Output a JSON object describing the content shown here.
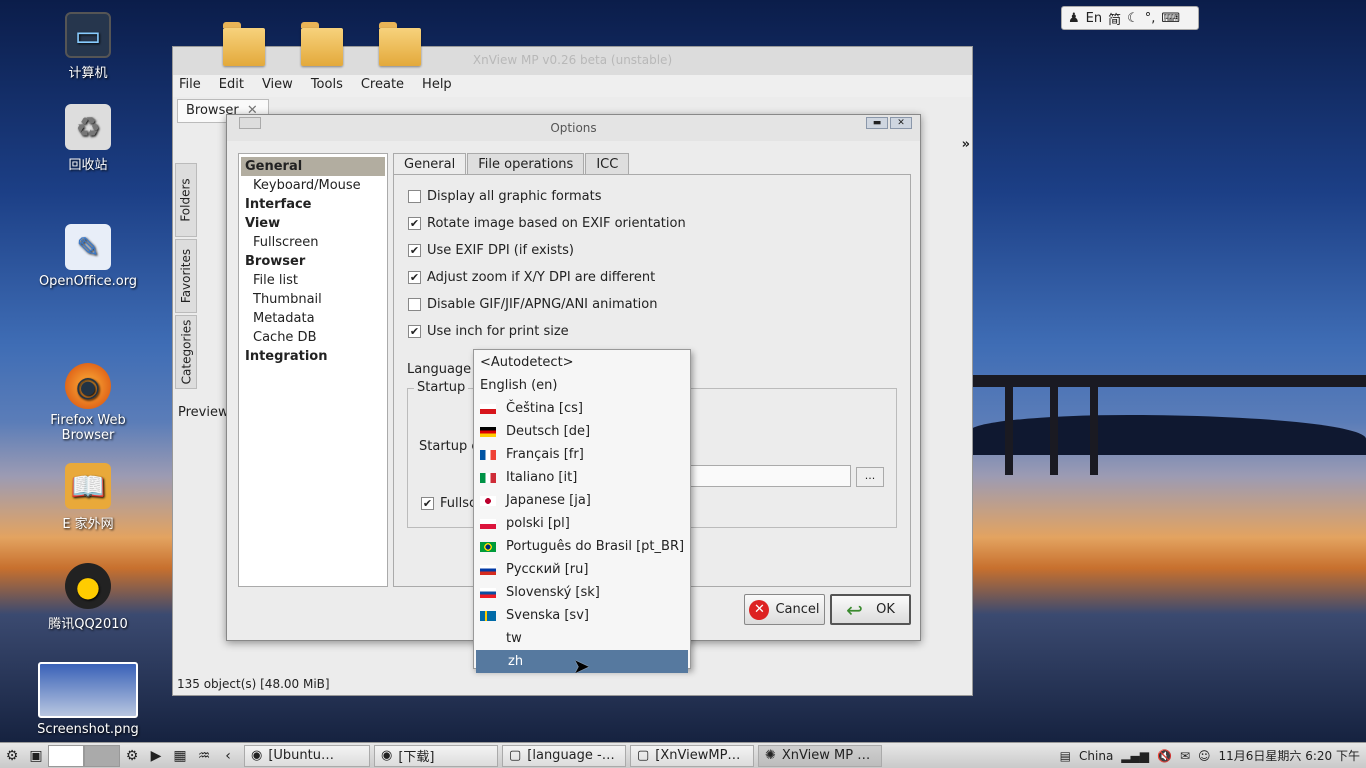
{
  "desktop": {
    "icons": [
      {
        "label": "计算机",
        "icon": "computer-icon"
      },
      {
        "label": "回收站",
        "icon": "trash-icon"
      },
      {
        "label": "OpenOffice.org",
        "icon": "openoffice-icon"
      },
      {
        "label": "Firefox Web Browser",
        "icon": "firefox-icon"
      },
      {
        "label": "E 家外网",
        "icon": "book-icon"
      },
      {
        "label": "腾讯QQ2010",
        "icon": "qq-penguin-icon"
      },
      {
        "label": "Screenshot.png",
        "icon": "image-thumbnail-icon"
      }
    ]
  },
  "ime": {
    "lang": "En",
    "mode": "简"
  },
  "xnview": {
    "title": "XnView MP v0.26 beta (unstable)",
    "menu": [
      "File",
      "Edit",
      "View",
      "Tools",
      "Create",
      "Help"
    ],
    "tab": "Browser",
    "side_tabs": [
      "Folders",
      "Favorites",
      "Categories"
    ],
    "preview": "Preview",
    "status": "135 object(s) [48.00 MiB]"
  },
  "dialog": {
    "title": "Options",
    "tree": [
      {
        "label": "General",
        "bold": true,
        "selected": true
      },
      {
        "label": "Keyboard/Mouse",
        "bold": false
      },
      {
        "label": "Interface",
        "bold": true
      },
      {
        "label": "View",
        "bold": true
      },
      {
        "label": "Fullscreen",
        "bold": false
      },
      {
        "label": "Browser",
        "bold": true
      },
      {
        "label": "File list",
        "bold": false
      },
      {
        "label": "Thumbnail",
        "bold": false
      },
      {
        "label": "Metadata",
        "bold": false
      },
      {
        "label": "Cache DB",
        "bold": false
      },
      {
        "label": "Integration",
        "bold": true
      }
    ],
    "tabs": [
      "General",
      "File operations",
      "ICC"
    ],
    "checkboxes": [
      {
        "label": "Display all graphic formats",
        "checked": false
      },
      {
        "label": "Rotate image based on EXIF orientation",
        "checked": true
      },
      {
        "label": "Use EXIF DPI (if exists)",
        "checked": true
      },
      {
        "label": "Adjust zoom if X/Y DPI are different",
        "checked": true
      },
      {
        "label": "Disable GIF/JIF/APNG/ANI animation",
        "checked": false
      },
      {
        "label": "Use inch for print size",
        "checked": true
      }
    ],
    "language_label": "Language",
    "startup_label": "Startup",
    "startup_c": "Startup c",
    "fullsc": "Fullsc",
    "fullsc_checked": true,
    "dots": "...",
    "cancel": "Cancel",
    "ok": "OK"
  },
  "language_dropdown": [
    {
      "label": "<Autodetect>",
      "flag": null
    },
    {
      "label": "English (en)",
      "flag": null
    },
    {
      "label": "Čeština [cs]",
      "flag": "cz"
    },
    {
      "label": "Deutsch [de]",
      "flag": "de"
    },
    {
      "label": "Français [fr]",
      "flag": "fr"
    },
    {
      "label": "Italiano [it]",
      "flag": "it"
    },
    {
      "label": "Japanese [ja]",
      "flag": "ja"
    },
    {
      "label": "polski [pl]",
      "flag": "pl"
    },
    {
      "label": "Português do Brasil [pt_BR]",
      "flag": "br"
    },
    {
      "label": "Русский [ru]",
      "flag": "ru"
    },
    {
      "label": "Slovenský [sk]",
      "flag": "sk"
    },
    {
      "label": "Svenska [sv]",
      "flag": "sv"
    },
    {
      "label": "tw",
      "flag": "none"
    },
    {
      "label": "zh",
      "flag": "none",
      "selected": true
    }
  ],
  "taskbar": {
    "tasks": [
      {
        "label": "[Ubuntu…",
        "icon": "firefox-icon",
        "active": false
      },
      {
        "label": "[下载]",
        "icon": "firefox-icon",
        "active": false
      },
      {
        "label": "[language -…",
        "icon": "editor-icon",
        "active": false
      },
      {
        "label": "[XnViewMP…",
        "icon": "editor-icon",
        "active": false
      },
      {
        "label": "XnView MP …",
        "icon": "xnview-icon",
        "active": true
      }
    ],
    "network": "China",
    "datetime": "11月6日星期六  6:20 下午"
  }
}
